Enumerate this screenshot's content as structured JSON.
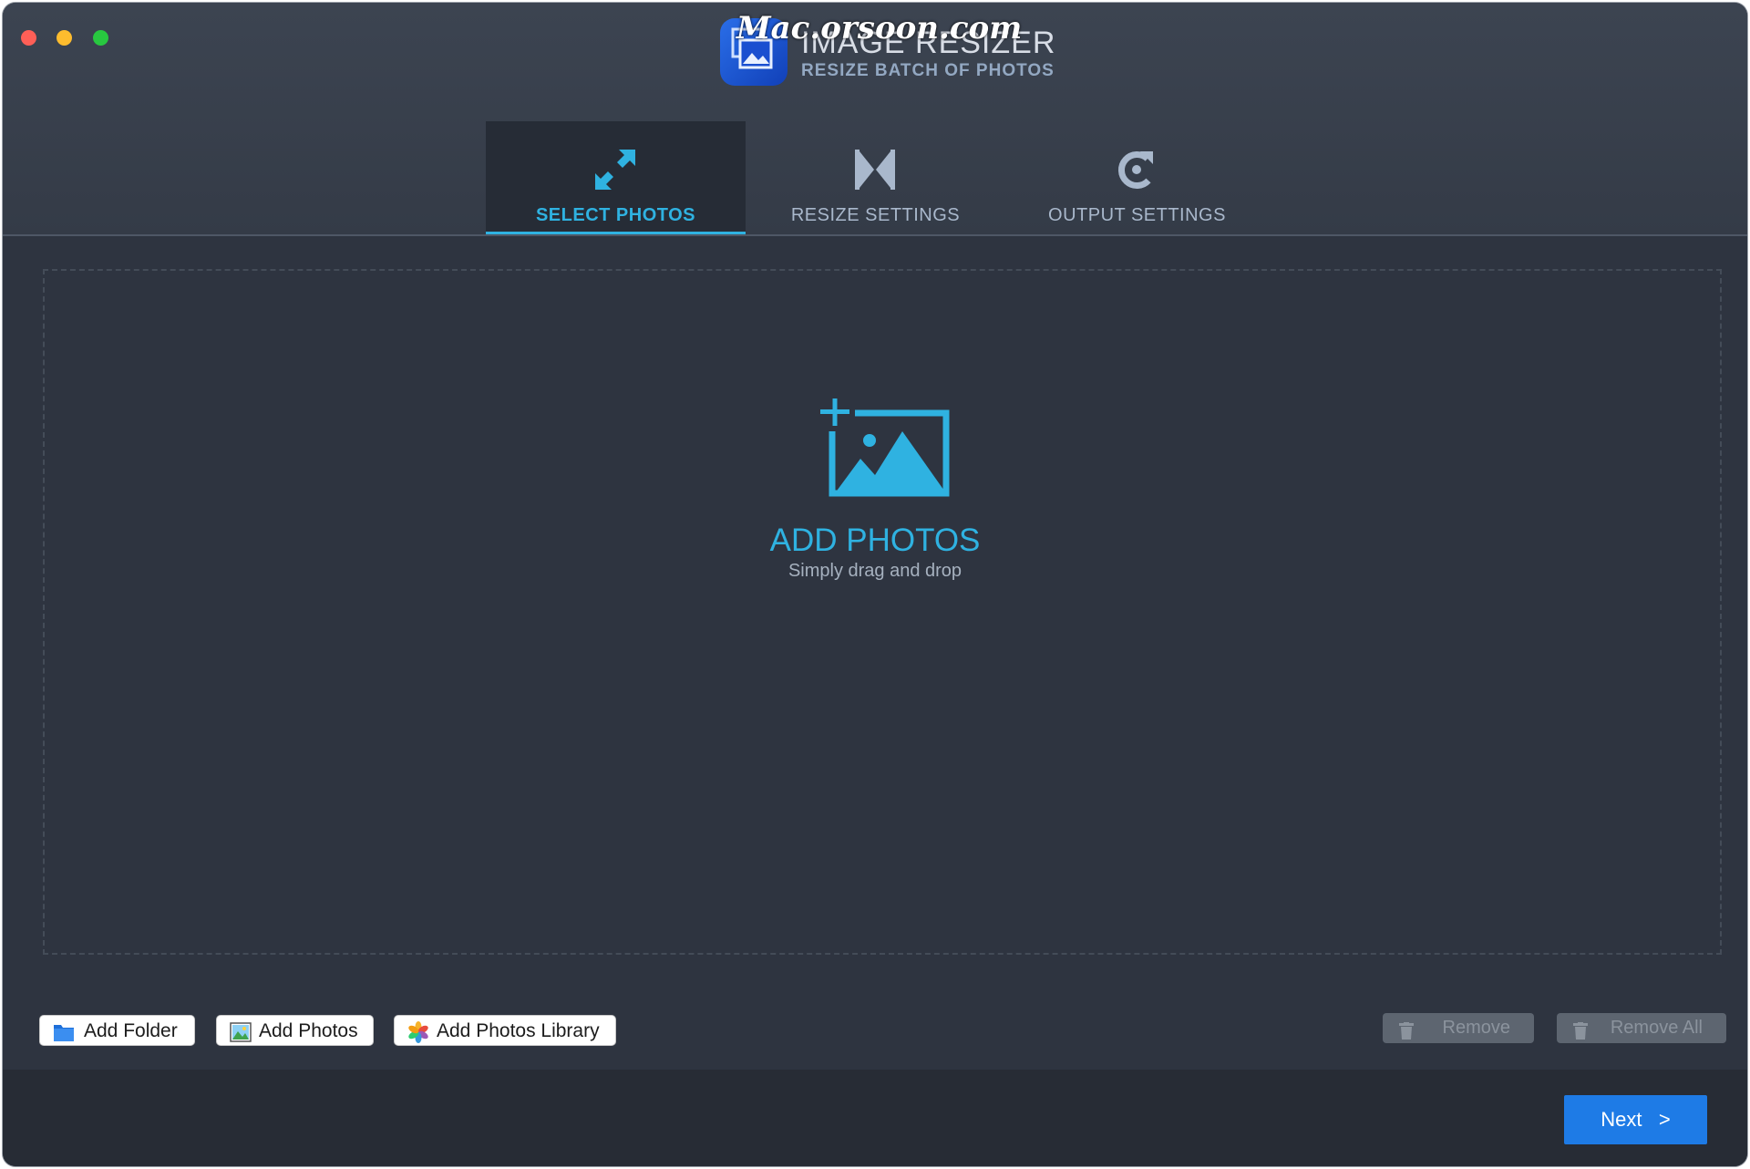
{
  "window": {
    "app_title": "IMAGE RESIZER",
    "app_subtitle": "RESIZE BATCH OF PHOTOS",
    "watermark": "Mac.orsoon.com"
  },
  "tabs": [
    {
      "label": "SELECT PHOTOS",
      "icon": "expand-arrows-icon",
      "active": true
    },
    {
      "label": "RESIZE SETTINGS",
      "icon": "resize-bowtie-icon",
      "active": false
    },
    {
      "label": "OUTPUT SETTINGS",
      "icon": "refresh-icon",
      "active": false
    }
  ],
  "dropzone": {
    "title": "ADD PHOTOS",
    "subtitle": "Simply drag and drop",
    "icon": "add-image-icon"
  },
  "toolbar": {
    "add_folder": "Add Folder",
    "add_photos": "Add Photos",
    "add_photos_library": "Add Photos Library",
    "remove": "Remove",
    "remove_all": "Remove All"
  },
  "footer": {
    "next_label": "Next   >"
  },
  "colors": {
    "accent": "#2fb2e1",
    "background": "#2e3440",
    "primary_button": "#1e7be6"
  }
}
